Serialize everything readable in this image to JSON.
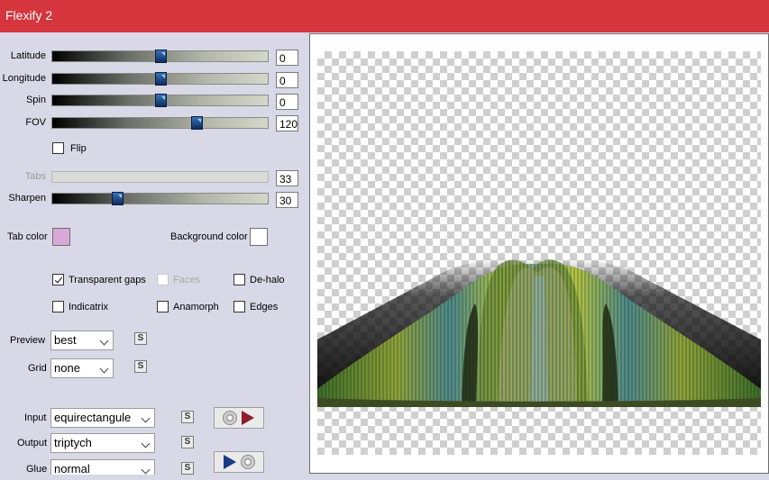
{
  "window": {
    "title": "Flexify 2",
    "accent": "#d5353c"
  },
  "sliders": [
    {
      "label": "Latitude",
      "value": "0",
      "level": 0.5,
      "enabled": true
    },
    {
      "label": "Longitude",
      "value": "0",
      "level": 0.5,
      "enabled": true
    },
    {
      "label": "Spin",
      "value": "0",
      "level": 0.5,
      "enabled": true
    },
    {
      "label": "FOV",
      "value": "120",
      "level": 0.67,
      "enabled": true
    },
    {
      "label": "Tabs",
      "value": "33",
      "level": 0.33,
      "enabled": false
    },
    {
      "label": "Sharpen",
      "value": "30",
      "level": 0.3,
      "enabled": true
    }
  ],
  "flip": {
    "label": "Flip",
    "checked": false
  },
  "colors": {
    "tab_label": "Tab color",
    "tab_value": "#d8a9d8",
    "bg_label": "Background color",
    "bg_value": "#ffffff"
  },
  "options": {
    "transparent_gaps": {
      "label": "Transparent gaps",
      "checked": true
    },
    "faces": {
      "label": "Faces",
      "checked": false,
      "enabled": false
    },
    "de_halo": {
      "label": "De-halo",
      "checked": false
    },
    "indicatrix": {
      "label": "Indicatrix",
      "checked": false
    },
    "anamorph": {
      "label": "Anamorph",
      "checked": false
    },
    "edges": {
      "label": "Edges",
      "checked": false
    }
  },
  "preview_select": {
    "label": "Preview",
    "value": "best"
  },
  "grid_select": {
    "label": "Grid",
    "value": "none"
  },
  "input_select": {
    "label": "Input",
    "value": "equirectangule"
  },
  "output_select": {
    "label": "Output",
    "value": "triptych"
  },
  "glue_select": {
    "label": "Glue",
    "value": "normal"
  },
  "lock_glyph": "S",
  "icons": {
    "input_convert": [
      "disc-icon",
      "red-arrow-icon"
    ],
    "output_convert": [
      "blue-arrow-icon",
      "disc-icon"
    ]
  }
}
